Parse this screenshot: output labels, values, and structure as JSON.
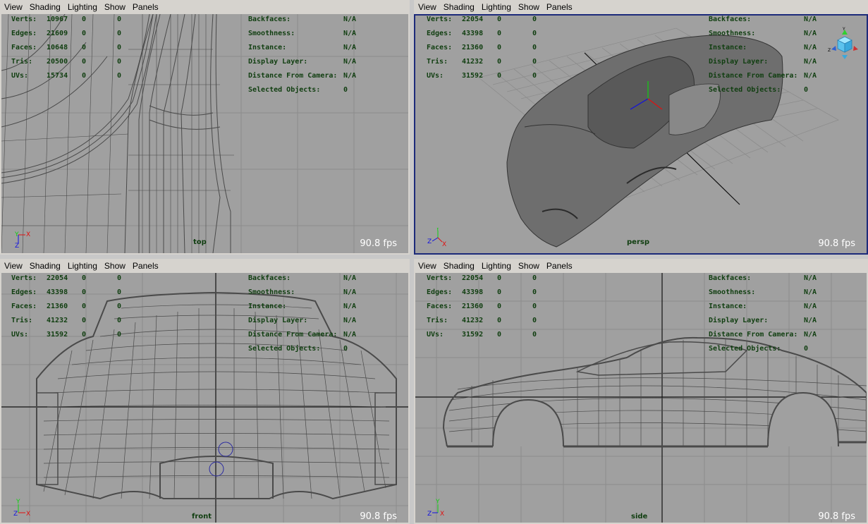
{
  "menu": [
    "View",
    "Shading",
    "Lighting",
    "Show",
    "Panels"
  ],
  "viewports": [
    {
      "camera": "top",
      "fps": "90.8 fps",
      "stats": [
        {
          "label": "Verts:",
          "v1": "10967",
          "v2": "0",
          "v3": "0"
        },
        {
          "label": "Edges:",
          "v1": "21609",
          "v2": "0",
          "v3": "0"
        },
        {
          "label": "Faces:",
          "v1": "10648",
          "v2": "0",
          "v3": "0"
        },
        {
          "label": "Tris:",
          "v1": "20500",
          "v2": "0",
          "v3": "0"
        },
        {
          "label": "UVs:",
          "v1": "15734",
          "v2": "0",
          "v3": "0"
        }
      ],
      "info": [
        {
          "label": "Backfaces:",
          "value": "N/A"
        },
        {
          "label": "Smoothness:",
          "value": "N/A"
        },
        {
          "label": "Instance:",
          "value": "N/A"
        },
        {
          "label": "Display Layer:",
          "value": "N/A"
        },
        {
          "label": "Distance From Camera:",
          "value": "N/A"
        },
        {
          "label": "Selected Objects:",
          "value": "0"
        }
      ]
    },
    {
      "camera": "persp",
      "fps": "90.8 fps",
      "stats": [
        {
          "label": "Verts:",
          "v1": "22054",
          "v2": "0",
          "v3": "0"
        },
        {
          "label": "Edges:",
          "v1": "43398",
          "v2": "0",
          "v3": "0"
        },
        {
          "label": "Faces:",
          "v1": "21360",
          "v2": "0",
          "v3": "0"
        },
        {
          "label": "Tris:",
          "v1": "41232",
          "v2": "0",
          "v3": "0"
        },
        {
          "label": "UVs:",
          "v1": "31592",
          "v2": "0",
          "v3": "0"
        }
      ],
      "info": [
        {
          "label": "Backfaces:",
          "value": "N/A"
        },
        {
          "label": "Smoothness:",
          "value": "N/A"
        },
        {
          "label": "Instance:",
          "value": "N/A"
        },
        {
          "label": "Display Layer:",
          "value": "N/A"
        },
        {
          "label": "Distance From Camera:",
          "value": "N/A"
        },
        {
          "label": "Selected Objects:",
          "value": "0"
        }
      ]
    },
    {
      "camera": "front",
      "fps": "90.8 fps",
      "stats": [
        {
          "label": "Verts:",
          "v1": "22054",
          "v2": "0",
          "v3": "0"
        },
        {
          "label": "Edges:",
          "v1": "43398",
          "v2": "0",
          "v3": "0"
        },
        {
          "label": "Faces:",
          "v1": "21360",
          "v2": "0",
          "v3": "0"
        },
        {
          "label": "Tris:",
          "v1": "41232",
          "v2": "0",
          "v3": "0"
        },
        {
          "label": "UVs:",
          "v1": "31592",
          "v2": "0",
          "v3": "0"
        }
      ],
      "info": [
        {
          "label": "Backfaces:",
          "value": "N/A"
        },
        {
          "label": "Smoothness:",
          "value": "N/A"
        },
        {
          "label": "Instance:",
          "value": "N/A"
        },
        {
          "label": "Display Layer:",
          "value": "N/A"
        },
        {
          "label": "Distance From Camera:",
          "value": "N/A"
        },
        {
          "label": "Selected Objects:",
          "value": "0"
        }
      ]
    },
    {
      "camera": "side",
      "fps": "90.8 fps",
      "stats": [
        {
          "label": "Verts:",
          "v1": "22054",
          "v2": "0",
          "v3": "0"
        },
        {
          "label": "Edges:",
          "v1": "43398",
          "v2": "0",
          "v3": "0"
        },
        {
          "label": "Faces:",
          "v1": "21360",
          "v2": "0",
          "v3": "0"
        },
        {
          "label": "Tris:",
          "v1": "41232",
          "v2": "0",
          "v3": "0"
        },
        {
          "label": "UVs:",
          "v1": "31592",
          "v2": "0",
          "v3": "0"
        }
      ],
      "info": [
        {
          "label": "Backfaces:",
          "value": "N/A"
        },
        {
          "label": "Smoothness:",
          "value": "N/A"
        },
        {
          "label": "Instance:",
          "value": "N/A"
        },
        {
          "label": "Display Layer:",
          "value": "N/A"
        },
        {
          "label": "Distance From Camera:",
          "value": "N/A"
        },
        {
          "label": "Selected Objects:",
          "value": "0"
        }
      ]
    }
  ],
  "colors": {
    "viewport_bg": "#a0a0a0",
    "grid": "#8c8c8c",
    "wire": "#4a4a4a",
    "hud_text": "#103e10",
    "active_border": "#1c2a7a",
    "axis_x": "#e01010",
    "axis_y": "#10d010",
    "axis_z": "#1010e0"
  }
}
